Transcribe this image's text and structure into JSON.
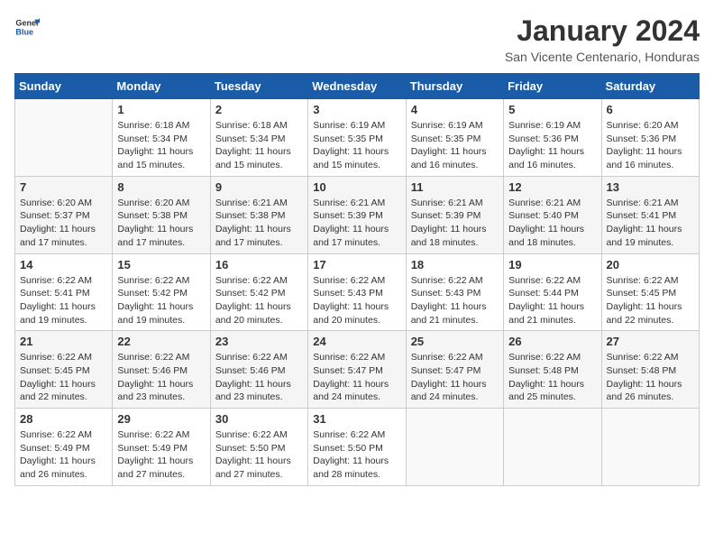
{
  "header": {
    "logo_line1": "General",
    "logo_line2": "Blue",
    "month": "January 2024",
    "location": "San Vicente Centenario, Honduras"
  },
  "days_of_week": [
    "Sunday",
    "Monday",
    "Tuesday",
    "Wednesday",
    "Thursday",
    "Friday",
    "Saturday"
  ],
  "weeks": [
    [
      {
        "day": "",
        "sunrise": "",
        "sunset": "",
        "daylight": ""
      },
      {
        "day": "1",
        "sunrise": "Sunrise: 6:18 AM",
        "sunset": "Sunset: 5:34 PM",
        "daylight": "Daylight: 11 hours and 15 minutes."
      },
      {
        "day": "2",
        "sunrise": "Sunrise: 6:18 AM",
        "sunset": "Sunset: 5:34 PM",
        "daylight": "Daylight: 11 hours and 15 minutes."
      },
      {
        "day": "3",
        "sunrise": "Sunrise: 6:19 AM",
        "sunset": "Sunset: 5:35 PM",
        "daylight": "Daylight: 11 hours and 15 minutes."
      },
      {
        "day": "4",
        "sunrise": "Sunrise: 6:19 AM",
        "sunset": "Sunset: 5:35 PM",
        "daylight": "Daylight: 11 hours and 16 minutes."
      },
      {
        "day": "5",
        "sunrise": "Sunrise: 6:19 AM",
        "sunset": "Sunset: 5:36 PM",
        "daylight": "Daylight: 11 hours and 16 minutes."
      },
      {
        "day": "6",
        "sunrise": "Sunrise: 6:20 AM",
        "sunset": "Sunset: 5:36 PM",
        "daylight": "Daylight: 11 hours and 16 minutes."
      }
    ],
    [
      {
        "day": "7",
        "sunrise": "Sunrise: 6:20 AM",
        "sunset": "Sunset: 5:37 PM",
        "daylight": "Daylight: 11 hours and 17 minutes."
      },
      {
        "day": "8",
        "sunrise": "Sunrise: 6:20 AM",
        "sunset": "Sunset: 5:38 PM",
        "daylight": "Daylight: 11 hours and 17 minutes."
      },
      {
        "day": "9",
        "sunrise": "Sunrise: 6:21 AM",
        "sunset": "Sunset: 5:38 PM",
        "daylight": "Daylight: 11 hours and 17 minutes."
      },
      {
        "day": "10",
        "sunrise": "Sunrise: 6:21 AM",
        "sunset": "Sunset: 5:39 PM",
        "daylight": "Daylight: 11 hours and 17 minutes."
      },
      {
        "day": "11",
        "sunrise": "Sunrise: 6:21 AM",
        "sunset": "Sunset: 5:39 PM",
        "daylight": "Daylight: 11 hours and 18 minutes."
      },
      {
        "day": "12",
        "sunrise": "Sunrise: 6:21 AM",
        "sunset": "Sunset: 5:40 PM",
        "daylight": "Daylight: 11 hours and 18 minutes."
      },
      {
        "day": "13",
        "sunrise": "Sunrise: 6:21 AM",
        "sunset": "Sunset: 5:41 PM",
        "daylight": "Daylight: 11 hours and 19 minutes."
      }
    ],
    [
      {
        "day": "14",
        "sunrise": "Sunrise: 6:22 AM",
        "sunset": "Sunset: 5:41 PM",
        "daylight": "Daylight: 11 hours and 19 minutes."
      },
      {
        "day": "15",
        "sunrise": "Sunrise: 6:22 AM",
        "sunset": "Sunset: 5:42 PM",
        "daylight": "Daylight: 11 hours and 19 minutes."
      },
      {
        "day": "16",
        "sunrise": "Sunrise: 6:22 AM",
        "sunset": "Sunset: 5:42 PM",
        "daylight": "Daylight: 11 hours and 20 minutes."
      },
      {
        "day": "17",
        "sunrise": "Sunrise: 6:22 AM",
        "sunset": "Sunset: 5:43 PM",
        "daylight": "Daylight: 11 hours and 20 minutes."
      },
      {
        "day": "18",
        "sunrise": "Sunrise: 6:22 AM",
        "sunset": "Sunset: 5:43 PM",
        "daylight": "Daylight: 11 hours and 21 minutes."
      },
      {
        "day": "19",
        "sunrise": "Sunrise: 6:22 AM",
        "sunset": "Sunset: 5:44 PM",
        "daylight": "Daylight: 11 hours and 21 minutes."
      },
      {
        "day": "20",
        "sunrise": "Sunrise: 6:22 AM",
        "sunset": "Sunset: 5:45 PM",
        "daylight": "Daylight: 11 hours and 22 minutes."
      }
    ],
    [
      {
        "day": "21",
        "sunrise": "Sunrise: 6:22 AM",
        "sunset": "Sunset: 5:45 PM",
        "daylight": "Daylight: 11 hours and 22 minutes."
      },
      {
        "day": "22",
        "sunrise": "Sunrise: 6:22 AM",
        "sunset": "Sunset: 5:46 PM",
        "daylight": "Daylight: 11 hours and 23 minutes."
      },
      {
        "day": "23",
        "sunrise": "Sunrise: 6:22 AM",
        "sunset": "Sunset: 5:46 PM",
        "daylight": "Daylight: 11 hours and 23 minutes."
      },
      {
        "day": "24",
        "sunrise": "Sunrise: 6:22 AM",
        "sunset": "Sunset: 5:47 PM",
        "daylight": "Daylight: 11 hours and 24 minutes."
      },
      {
        "day": "25",
        "sunrise": "Sunrise: 6:22 AM",
        "sunset": "Sunset: 5:47 PM",
        "daylight": "Daylight: 11 hours and 24 minutes."
      },
      {
        "day": "26",
        "sunrise": "Sunrise: 6:22 AM",
        "sunset": "Sunset: 5:48 PM",
        "daylight": "Daylight: 11 hours and 25 minutes."
      },
      {
        "day": "27",
        "sunrise": "Sunrise: 6:22 AM",
        "sunset": "Sunset: 5:48 PM",
        "daylight": "Daylight: 11 hours and 26 minutes."
      }
    ],
    [
      {
        "day": "28",
        "sunrise": "Sunrise: 6:22 AM",
        "sunset": "Sunset: 5:49 PM",
        "daylight": "Daylight: 11 hours and 26 minutes."
      },
      {
        "day": "29",
        "sunrise": "Sunrise: 6:22 AM",
        "sunset": "Sunset: 5:49 PM",
        "daylight": "Daylight: 11 hours and 27 minutes."
      },
      {
        "day": "30",
        "sunrise": "Sunrise: 6:22 AM",
        "sunset": "Sunset: 5:50 PM",
        "daylight": "Daylight: 11 hours and 27 minutes."
      },
      {
        "day": "31",
        "sunrise": "Sunrise: 6:22 AM",
        "sunset": "Sunset: 5:50 PM",
        "daylight": "Daylight: 11 hours and 28 minutes."
      },
      {
        "day": "",
        "sunrise": "",
        "sunset": "",
        "daylight": ""
      },
      {
        "day": "",
        "sunrise": "",
        "sunset": "",
        "daylight": ""
      },
      {
        "day": "",
        "sunrise": "",
        "sunset": "",
        "daylight": ""
      }
    ]
  ]
}
